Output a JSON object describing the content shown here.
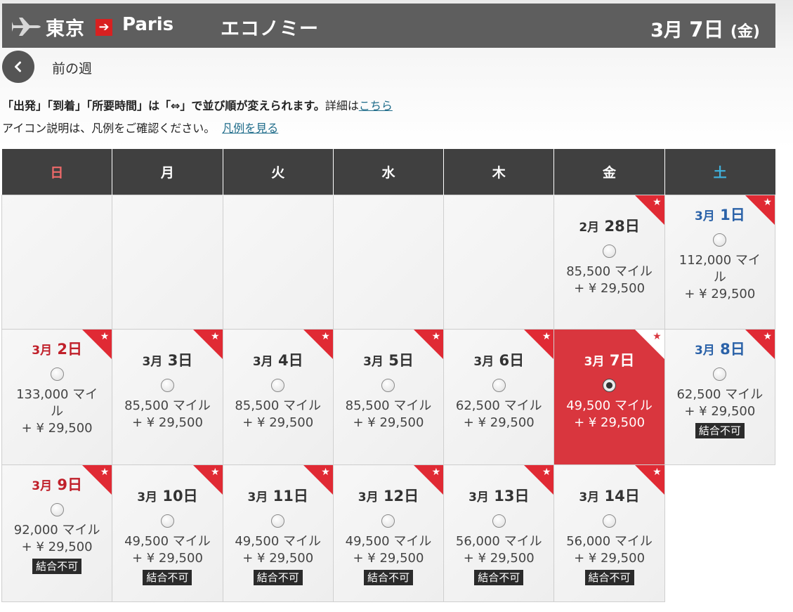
{
  "header": {
    "from": "東京",
    "to": "Paris",
    "cabin": "エコノミー",
    "date_month": "3月",
    "date_day": "7日",
    "date_weekday": "(金)",
    "arrow": "➔"
  },
  "nav": {
    "prev_label": "前の週"
  },
  "info": {
    "line1_bold": "「出発」「到着」「所要時間」は「⇔」で並び順が変えられます。",
    "line1_text": "詳細は",
    "line1_link": "こちら",
    "line2_text": "アイコン説明は、凡例をご確認ください。",
    "line2_link": "凡例を見る"
  },
  "weekdays": [
    "日",
    "月",
    "火",
    "水",
    "木",
    "金",
    "土"
  ],
  "weeks": [
    [
      null,
      null,
      null,
      null,
      null,
      {
        "month": "2月",
        "day": "28日",
        "miles": "85,500 マイル",
        "tax": "+ ¥ 29,500",
        "badge": ""
      },
      {
        "month": "3月",
        "day": "1日",
        "miles": "112,000 マイル",
        "tax": "+ ¥ 29,500",
        "badge": ""
      }
    ],
    [
      {
        "month": "3月",
        "day": "2日",
        "miles": "133,000 マイル",
        "tax": "+ ¥ 29,500",
        "badge": ""
      },
      {
        "month": "3月",
        "day": "3日",
        "miles": "85,500 マイル",
        "tax": "+ ¥ 29,500",
        "badge": ""
      },
      {
        "month": "3月",
        "day": "4日",
        "miles": "85,500 マイル",
        "tax": "+ ¥ 29,500",
        "badge": ""
      },
      {
        "month": "3月",
        "day": "5日",
        "miles": "85,500 マイル",
        "tax": "+ ¥ 29,500",
        "badge": ""
      },
      {
        "month": "3月",
        "day": "6日",
        "miles": "62,500 マイル",
        "tax": "+ ¥ 29,500",
        "badge": ""
      },
      {
        "month": "3月",
        "day": "7日",
        "miles": "49,500 マイル",
        "tax": "+ ¥ 29,500",
        "badge": "",
        "selected": true
      },
      {
        "month": "3月",
        "day": "8日",
        "miles": "62,500 マイル",
        "tax": "+ ¥ 29,500",
        "badge": "結合不可"
      }
    ],
    [
      {
        "month": "3月",
        "day": "9日",
        "miles": "92,000 マイル",
        "tax": "+ ¥ 29,500",
        "badge": "結合不可"
      },
      {
        "month": "3月",
        "day": "10日",
        "miles": "49,500 マイル",
        "tax": "+ ¥ 29,500",
        "badge": "結合不可"
      },
      {
        "month": "3月",
        "day": "11日",
        "miles": "49,500 マイル",
        "tax": "+ ¥ 29,500",
        "badge": "結合不可"
      },
      {
        "month": "3月",
        "day": "12日",
        "miles": "49,500 マイル",
        "tax": "+ ¥ 29,500",
        "badge": "結合不可"
      },
      {
        "month": "3月",
        "day": "13日",
        "miles": "56,000 マイル",
        "tax": "+ ¥ 29,500",
        "badge": "結合不可"
      },
      {
        "month": "3月",
        "day": "14日",
        "miles": "56,000 マイル",
        "tax": "+ ¥ 29,500",
        "badge": "結合不可"
      },
      null
    ]
  ],
  "icons": {
    "plane": "plane-icon",
    "arrow": "arrow-right-icon",
    "prev": "chevron-left-icon",
    "corner": "star-badge-icon",
    "star": "★"
  },
  "colors": {
    "header_bg": "#5e5e5e",
    "accent_red": "#d9363e",
    "sunday": "#c0202a",
    "saturday": "#2b62a8",
    "badge_bg": "#2b2b2b"
  }
}
